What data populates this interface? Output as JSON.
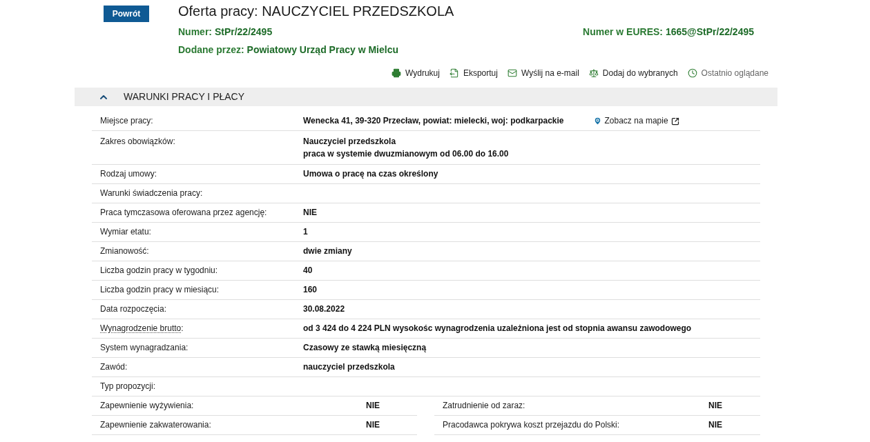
{
  "back_button": {
    "label": "Powrót"
  },
  "title": "Oferta pracy: NAUCZYCIEL PRZEDSZKOLA",
  "offer_number": {
    "label": "Numer:",
    "value": "StPr/22/2495"
  },
  "eures_number": {
    "label": "Numer w EURES:",
    "value": "1665@StPr/22/2495"
  },
  "added_by": {
    "label": "Dodane przez:",
    "value": "Powiatowy Urząd Pracy w Mielcu"
  },
  "actions": [
    {
      "kind": "print",
      "label": "Wydrukuj"
    },
    {
      "kind": "export",
      "label": "Eksportuj"
    },
    {
      "kind": "email",
      "label": "Wyślij na e-mail"
    },
    {
      "kind": "favorite",
      "label": "Dodaj do wybranych"
    },
    {
      "kind": "recent",
      "label": "Ostatnio oglądane"
    }
  ],
  "section": {
    "title": "WARUNKI PRACY I PŁACY",
    "expanded": true,
    "rows": [
      {
        "kind": "field",
        "label": "Miejsce pracy:",
        "value": "Wenecka 41, 39-320 Przecław, powiat: mielecki, woj: podkarpackie",
        "map_link": "Zobacz na mapie"
      },
      {
        "kind": "field",
        "label": "Zakres obowiązków:",
        "value_lines": [
          "Nauczyciel przedszkola",
          "praca w systemie dwuzmianowym od 06.00 do 16.00"
        ]
      },
      {
        "kind": "field",
        "label": "Rodzaj umowy:",
        "value": "Umowa o pracę na czas określony"
      },
      {
        "kind": "field",
        "label": "Warunki świadczenia pracy:"
      },
      {
        "kind": "field",
        "label": "Praca tymczasowa oferowana przez agencję:",
        "value": "NIE"
      },
      {
        "kind": "field",
        "label": "Wymiar etatu:",
        "value": "1"
      },
      {
        "kind": "field",
        "label": "Zmianowość:",
        "value": "dwie zmiany"
      },
      {
        "kind": "field",
        "label": "Liczba godzin pracy w tygodniu:",
        "value": "40"
      },
      {
        "kind": "field",
        "label": "Liczba godzin pracy w miesiącu:",
        "value": "160"
      },
      {
        "kind": "field",
        "label": "Data rozpoczęcia:",
        "value": "30.08.2022"
      },
      {
        "kind": "field",
        "label": "Wynagrodzenie brutto",
        "label_end": ":",
        "has_hint": true,
        "value": "od 3 424 do 4 224 PLN wysokośc wynagrodzenia uzależniona jest od stopnia awansu zawodowego"
      },
      {
        "kind": "field",
        "label": "System wynagradzania:",
        "value": "Czasowy ze stawką miesięczną"
      },
      {
        "kind": "field",
        "label": "Zawód:",
        "value": "nauczyciel przedszkola"
      },
      {
        "kind": "field",
        "label": "Typ propozycji:"
      },
      {
        "kind": "pair",
        "cells": [
          {
            "label": "Zapewnienie wyżywienia:",
            "value": "NIE"
          },
          {
            "label": "Zatrudnienie od zaraz:",
            "value": "NIE"
          }
        ]
      },
      {
        "kind": "pair",
        "cells": [
          {
            "label": "Zapewnienie zakwaterowania:",
            "value": "NIE"
          },
          {
            "label": "Pracodawca pokrywa koszt przejazdu do Polski:",
            "value": "NIE"
          }
        ]
      }
    ]
  }
}
